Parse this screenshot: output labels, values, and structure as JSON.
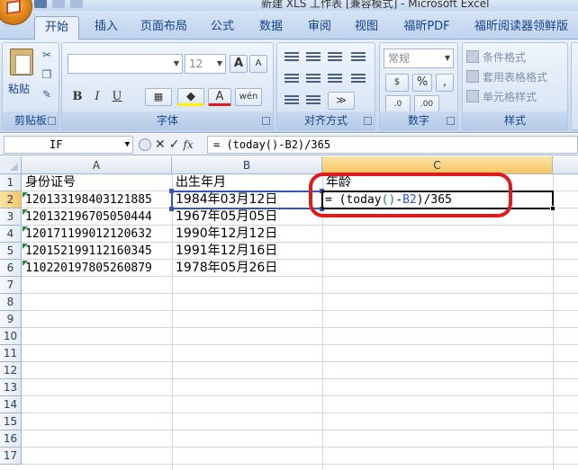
{
  "window": {
    "title": "新建 XLS 工作表 [兼容模式] - Microsoft Excel"
  },
  "ribbon_tabs": [
    {
      "label": "开始",
      "active": true
    },
    {
      "label": "插入"
    },
    {
      "label": "页面布局"
    },
    {
      "label": "公式"
    },
    {
      "label": "数据"
    },
    {
      "label": "审阅"
    },
    {
      "label": "视图"
    },
    {
      "label": "福昕PDF"
    },
    {
      "label": "福昕阅读器领鲜版"
    }
  ],
  "clipboard": {
    "paste_label": "粘贴",
    "group_label": "剪贴板"
  },
  "font": {
    "size_value": "12",
    "group_label": "字体",
    "grow_label": "A",
    "shrink_label": "A",
    "bold": "B",
    "italic": "I",
    "underline": "U",
    "wen": "wén"
  },
  "alignment": {
    "group_label": "对齐方式"
  },
  "number": {
    "format_value": "常规",
    "group_label": "数字",
    "percent": "%",
    "comma": ","
  },
  "styles": {
    "group_label": "样式",
    "items": [
      "条件格式",
      "套用表格格式",
      "单元格样式"
    ]
  },
  "formula_bar": {
    "name_box": "IF",
    "fx": "fx",
    "formula": "= (today()-B2)/365"
  },
  "columns": [
    {
      "label": "A",
      "selected": false
    },
    {
      "label": "B",
      "selected": false
    },
    {
      "label": "C",
      "selected": true
    }
  ],
  "rows": [
    "1",
    "2",
    "3",
    "4",
    "5",
    "6",
    "7",
    "8",
    "9",
    "10",
    "11",
    "12",
    "13",
    "14",
    "15",
    "16",
    "17"
  ],
  "selected_row": "2",
  "sheet": {
    "header": {
      "A": "身份证号",
      "B": "出生年月",
      "C": "年龄"
    },
    "data": [
      {
        "A": "120133198403121885",
        "B": "1984年03月12日"
      },
      {
        "A": "120132196705050444",
        "B": "1967年05月05日"
      },
      {
        "A": "120171199012120632",
        "B": "1990年12月12日"
      },
      {
        "A": "120152199112160345",
        "B": "1991年12月16日"
      },
      {
        "A": "110220197805260879",
        "B": "1978年05月26日"
      }
    ],
    "editing": {
      "prefix": "= (today",
      "paren_open": "(",
      "paren_close": ")",
      "minus": "-",
      "ref": "B2",
      "suffix": ")/365"
    }
  },
  "colors": {
    "accent": "#15428b",
    "annotation": "#e01b1b",
    "ref_border": "#3456b8",
    "formula_paren": "#1f8a3a"
  }
}
